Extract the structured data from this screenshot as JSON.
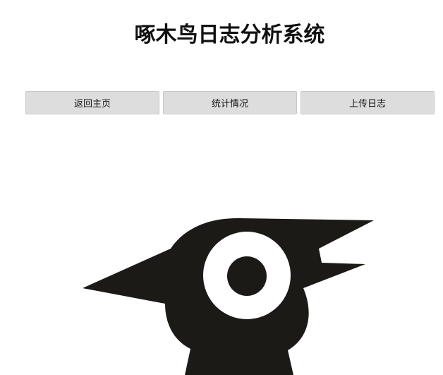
{
  "page": {
    "title": "啄木鸟日志分析系统"
  },
  "nav": {
    "buttons": [
      {
        "label": "返回主页"
      },
      {
        "label": "统计情况"
      },
      {
        "label": "上传日志"
      }
    ]
  },
  "logo": {
    "icon": "woodpecker-logo-icon",
    "fill_color": "#1c1a17",
    "eye_color": "#ffffff"
  }
}
